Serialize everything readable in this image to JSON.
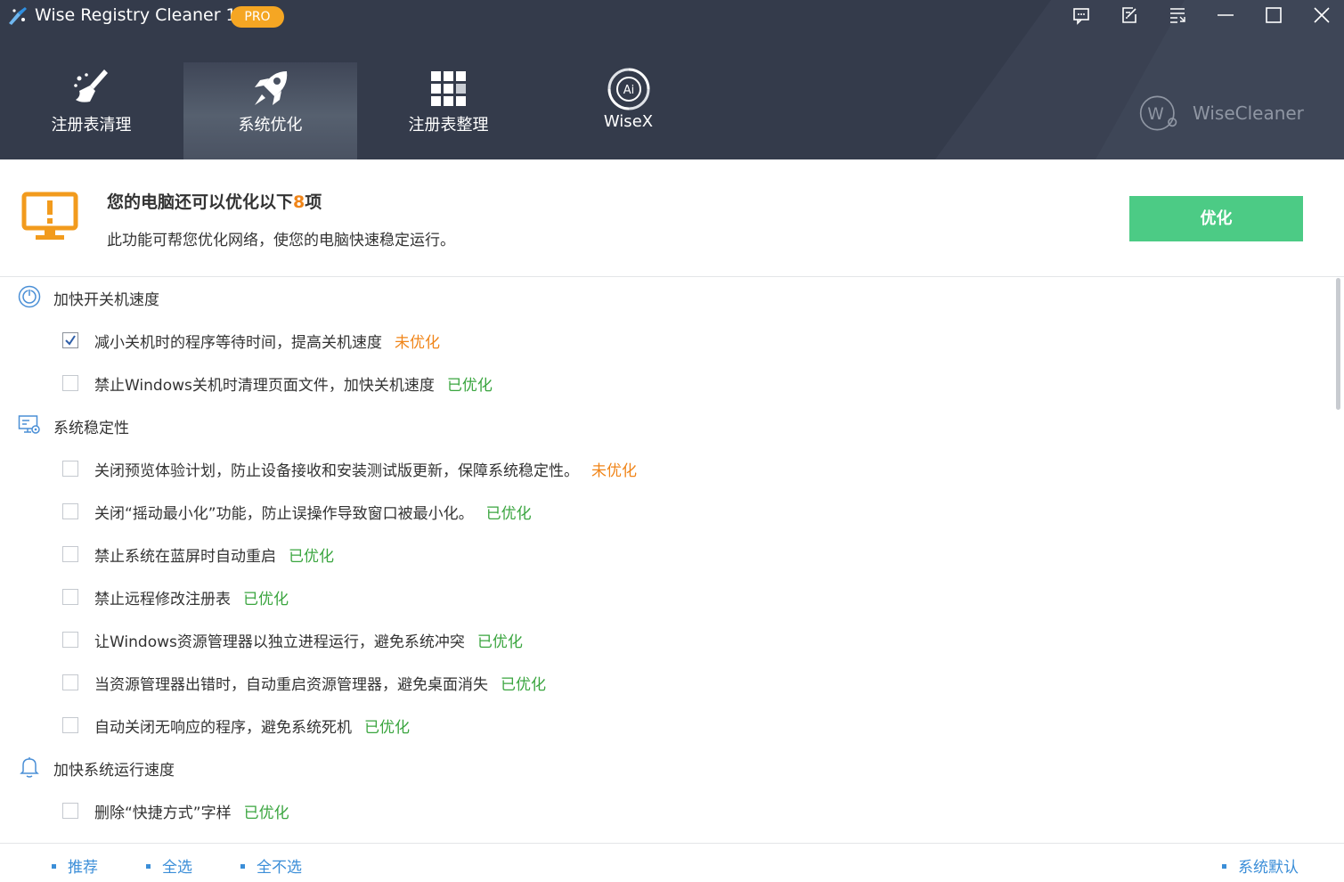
{
  "app": {
    "title": "Wise Registry Cleaner 11",
    "badge": "PRO",
    "brand": "WiseCleaner",
    "brand_letter": "W"
  },
  "window_controls": [
    {
      "name": "feedback-icon"
    },
    {
      "name": "edit-icon"
    },
    {
      "name": "menu-icon"
    },
    {
      "name": "minimize-icon"
    },
    {
      "name": "maximize-icon"
    },
    {
      "name": "close-icon"
    }
  ],
  "nav": {
    "items": [
      {
        "label": "注册表清理",
        "icon": "broom-icon",
        "active": false
      },
      {
        "label": "系统优化",
        "icon": "rocket-icon",
        "active": true
      },
      {
        "label": "注册表整理",
        "icon": "grid-icon",
        "active": false
      },
      {
        "label": "WiseX",
        "icon": "ai-icon",
        "active": false
      }
    ]
  },
  "status": {
    "title_prefix": "您的电脑还可以优化以下",
    "count": "8",
    "title_suffix": "项",
    "subtitle": "此功能可帮您优化网络，使您的电脑快速稳定运行。",
    "button": "优化"
  },
  "colors": {
    "header_bg": "#343b4b",
    "accent_orange": "#f08519",
    "ok_green": "#3aa53f",
    "button_green": "#4ccb85",
    "link_blue": "#3b8ed8"
  },
  "groups": [
    {
      "label": "加快开关机速度",
      "icon": "power-icon",
      "items": [
        {
          "text": "减小关机时的程序等待时间，提高关机速度",
          "status": "未优化",
          "state": "un",
          "checked": true
        },
        {
          "text": "禁止Windows关机时清理页面文件，加快关机速度",
          "status": "已优化",
          "state": "ok",
          "checked": false
        }
      ]
    },
    {
      "label": "系统稳定性",
      "icon": "monitor-settings-icon",
      "items": [
        {
          "text": "关闭预览体验计划，防止设备接收和安装测试版更新，保障系统稳定性。",
          "status": "未优化",
          "state": "un",
          "checked": false
        },
        {
          "text": "关闭“摇动最小化”功能，防止误操作导致窗口被最小化。",
          "status": "已优化",
          "state": "ok",
          "checked": false
        },
        {
          "text": "禁止系统在蓝屏时自动重启",
          "status": "已优化",
          "state": "ok",
          "checked": false
        },
        {
          "text": "禁止远程修改注册表",
          "status": "已优化",
          "state": "ok",
          "checked": false
        },
        {
          "text": "让Windows资源管理器以独立进程运行，避免系统冲突",
          "status": "已优化",
          "state": "ok",
          "checked": false
        },
        {
          "text": "当资源管理器出错时，自动重启资源管理器，避免桌面消失",
          "status": "已优化",
          "state": "ok",
          "checked": false
        },
        {
          "text": "自动关闭无响应的程序，避免系统死机",
          "status": "已优化",
          "state": "ok",
          "checked": false
        }
      ]
    },
    {
      "label": "加快系统运行速度",
      "icon": "bell-icon",
      "items": [
        {
          "text": "删除“快捷方式”字样",
          "status": "已优化",
          "state": "ok",
          "checked": false
        }
      ]
    }
  ],
  "footer": {
    "recommend": "推荐",
    "select_all": "全选",
    "select_none": "全不选",
    "system_default": "系统默认"
  }
}
